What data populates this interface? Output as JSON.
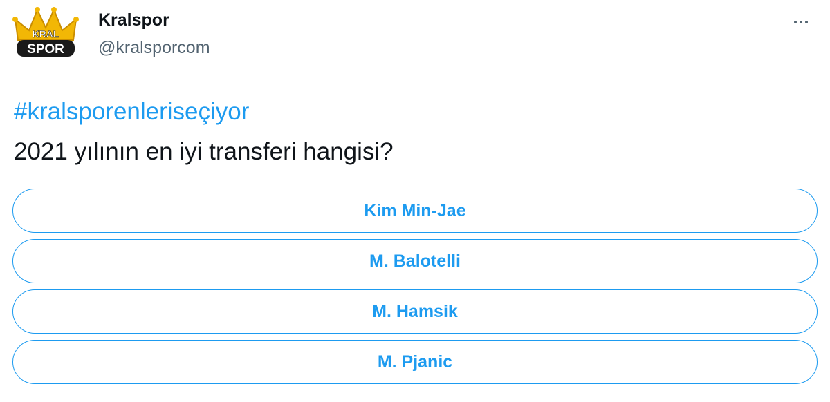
{
  "author": {
    "display_name": "Kralspor",
    "handle": "@kralsporcom",
    "avatar_logo_text": [
      "KRAL",
      "SPOR"
    ]
  },
  "tweet": {
    "hashtag": "#kralsporenleriseçiyor",
    "question": "2021 yılının en iyi transferi hangisi?"
  },
  "poll": {
    "options": [
      {
        "label": "Kim Min-Jae"
      },
      {
        "label": "M. Balotelli"
      },
      {
        "label": "M. Hamsik"
      },
      {
        "label": "M. Pjanic"
      }
    ]
  },
  "icons": {
    "more": "more-icon"
  },
  "colors": {
    "accent": "#1d9bf0",
    "text": "#0f1419",
    "secondary": "#536471",
    "logo_gold": "#f2b705"
  }
}
